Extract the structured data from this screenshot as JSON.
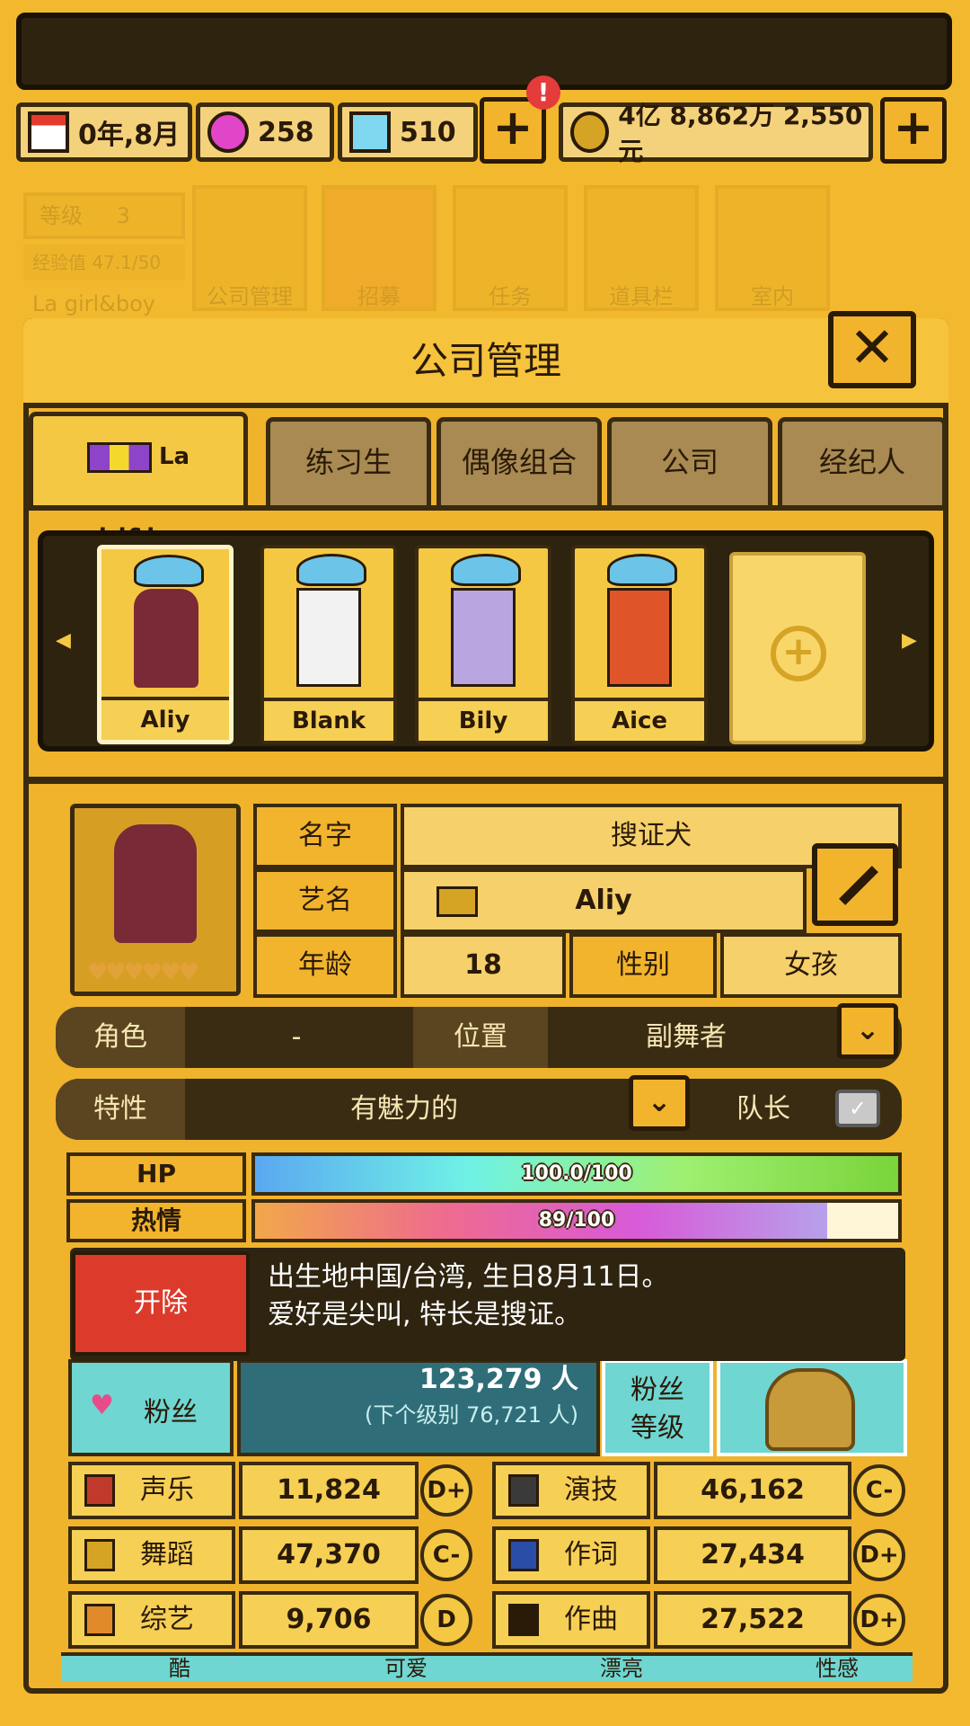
{
  "resources": {
    "date": "0年,8月",
    "gem_pink": "258",
    "gem_blue": "510",
    "notify_badge": "!",
    "money": "4亿 8,862万 2,550元",
    "plus_label": "+"
  },
  "background_nav": {
    "level_label": "等级",
    "level_value": "3",
    "exp_label": "经验值 47.1/50",
    "group_name": "La girl&boy",
    "items": [
      "公司管理",
      "招募",
      "任务",
      "道具栏",
      "室内"
    ]
  },
  "panel": {
    "title": "公司管理",
    "close_label": "✕",
    "tabs": [
      "La girl&boy",
      "练习生",
      "偶像组合",
      "公司",
      "经纪人"
    ]
  },
  "members": [
    {
      "name": "Aliy"
    },
    {
      "name": "Blank"
    },
    {
      "name": "Bily"
    },
    {
      "name": "Aice"
    }
  ],
  "add_label": "+",
  "profile": {
    "name_label": "名字",
    "name_value": "搜证犬",
    "stage_label": "艺名",
    "stage_value": "Aliy",
    "age_label": "年龄",
    "age_value": "18",
    "gender_label": "性别",
    "gender_value": "女孩",
    "hearts": "♥♥♥♥♥♥"
  },
  "role": {
    "role_label": "角色",
    "role_value": "-",
    "position_label": "位置",
    "position_value": "副舞者",
    "trait_label": "特性",
    "trait_value": "有魅力的",
    "leader_label": "队长"
  },
  "stats_bars": {
    "hp_label": "HP",
    "hp_text": "100.0/100",
    "hp_fraction": 1.0,
    "passion_label": "热情",
    "passion_text": "89/100",
    "passion_fraction": 0.89
  },
  "tooltip": {
    "fire_label": "开除",
    "bio_line1": "出生地中国/台湾, 生日8月11日。",
    "bio_line2": "爱好是尖叫, 特长是搜证。"
  },
  "fans": {
    "label": "粉丝",
    "count": "123,279 人",
    "next": "(下个级别 76,721 人)",
    "level_label": "粉丝\n等级"
  },
  "abilities": [
    {
      "label": "声乐",
      "value": "11,824",
      "grade": "D+"
    },
    {
      "label": "演技",
      "value": "46,162",
      "grade": "C-"
    },
    {
      "label": "舞蹈",
      "value": "47,370",
      "grade": "C-"
    },
    {
      "label": "作词",
      "value": "27,434",
      "grade": "D+"
    },
    {
      "label": "综艺",
      "value": "9,706",
      "grade": "D"
    },
    {
      "label": "作曲",
      "value": "27,522",
      "grade": "D+"
    }
  ],
  "bottom_strip": [
    "酷",
    "可爱",
    "漂亮",
    "性感"
  ]
}
